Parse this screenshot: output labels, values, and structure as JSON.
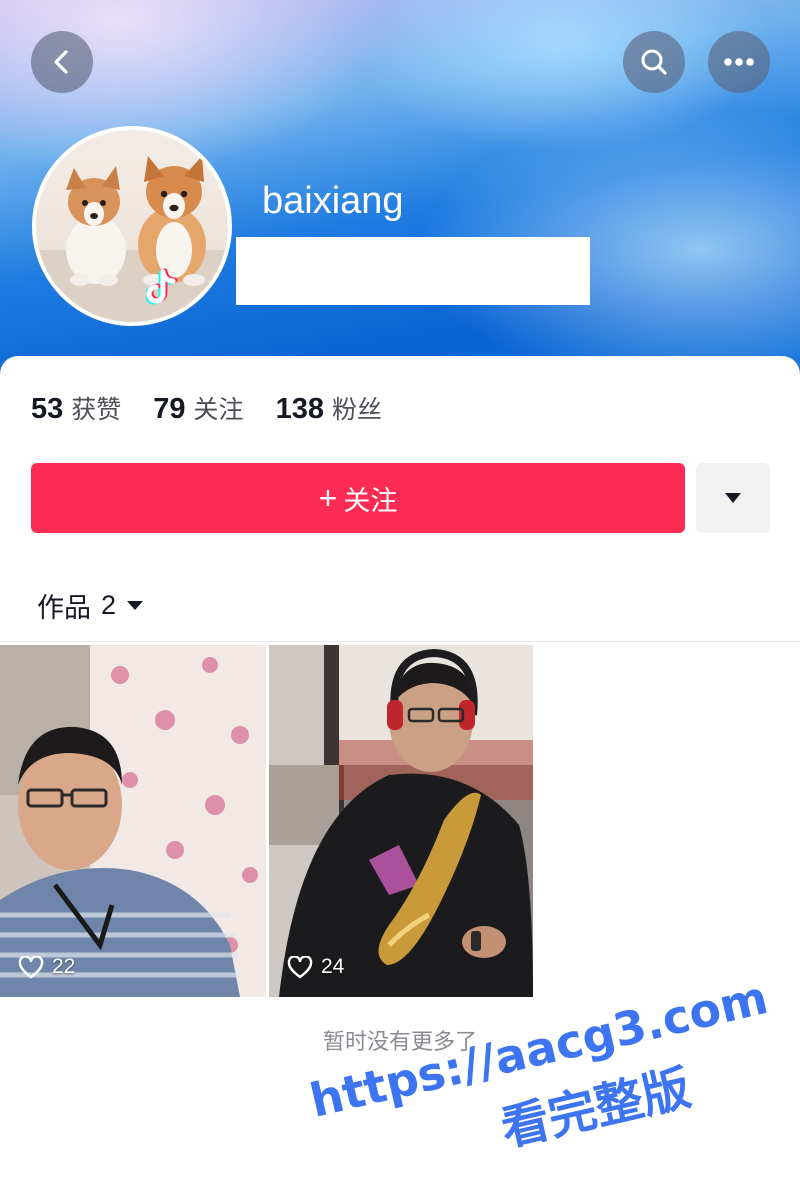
{
  "profile": {
    "username": "baixiang"
  },
  "stats": [
    {
      "value": "53",
      "label": "获赞"
    },
    {
      "value": "79",
      "label": "关注"
    },
    {
      "value": "138",
      "label": "粉丝"
    }
  ],
  "actions": {
    "follow_plus": "+",
    "follow_label": "关注"
  },
  "works_tab": {
    "label": "作品",
    "count": "2"
  },
  "videos": [
    {
      "likes": "22"
    },
    {
      "likes": "24"
    }
  ],
  "end_text": "暂时没有更多了",
  "watermark": {
    "line1": "https://aacg3.com",
    "line2": "看完整版"
  },
  "icons": {
    "back": "chevron-left-icon",
    "search": "search-icon",
    "more": "more-icon",
    "dropdown": "triangle-down-icon",
    "like": "heart-icon",
    "badge": "tiktok-logo-icon"
  },
  "colors": {
    "accent": "#fe2c55",
    "watermark": "#3d74f2",
    "header_blue": "#0a63d3"
  }
}
